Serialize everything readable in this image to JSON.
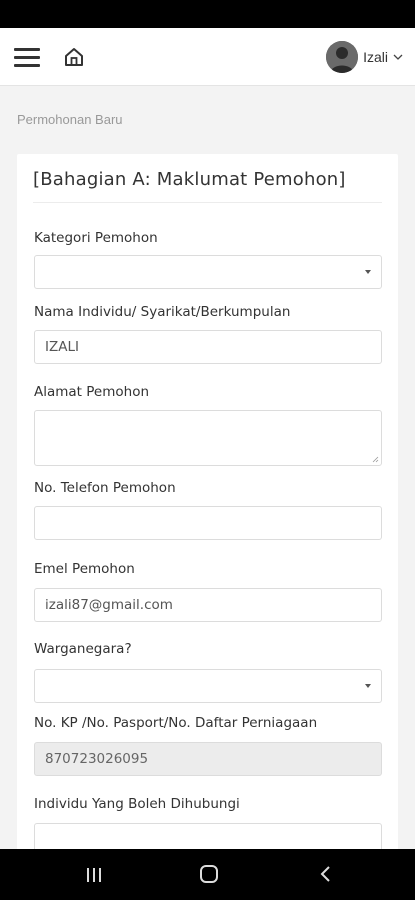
{
  "header": {
    "user_name": "Izali",
    "icons": {
      "menu": "hamburger-menu-icon",
      "home": "home-icon",
      "avatar": "user-avatar",
      "dropdown": "chevron-down-icon"
    }
  },
  "breadcrumb": "Permohonan Baru",
  "form": {
    "section_title": "[Bahagian A: Maklumat Pemohon]",
    "fields": [
      {
        "label": "Kategori Pemohon",
        "type": "select",
        "value": ""
      },
      {
        "label": "Nama Individu/ Syarikat/Berkumpulan",
        "type": "text",
        "value": "IZALI"
      },
      {
        "label": "Alamat Pemohon",
        "type": "textarea",
        "value": ""
      },
      {
        "label": "No. Telefon Pemohon",
        "type": "text",
        "value": ""
      },
      {
        "label": "Emel Pemohon",
        "type": "text",
        "value": "izali87@gmail.com"
      },
      {
        "label": "Warganegara?",
        "type": "select",
        "value": ""
      },
      {
        "label": "No. KP /No. Pasport/No. Daftar Perniagaan",
        "type": "text-disabled",
        "value": "870723026095"
      },
      {
        "label": "Individu Yang Boleh Dihubungi",
        "type": "text",
        "value": ""
      }
    ]
  },
  "android_nav": {
    "icons": {
      "recent": "recent-apps-icon",
      "home": "android-home-icon",
      "back": "back-icon"
    }
  }
}
